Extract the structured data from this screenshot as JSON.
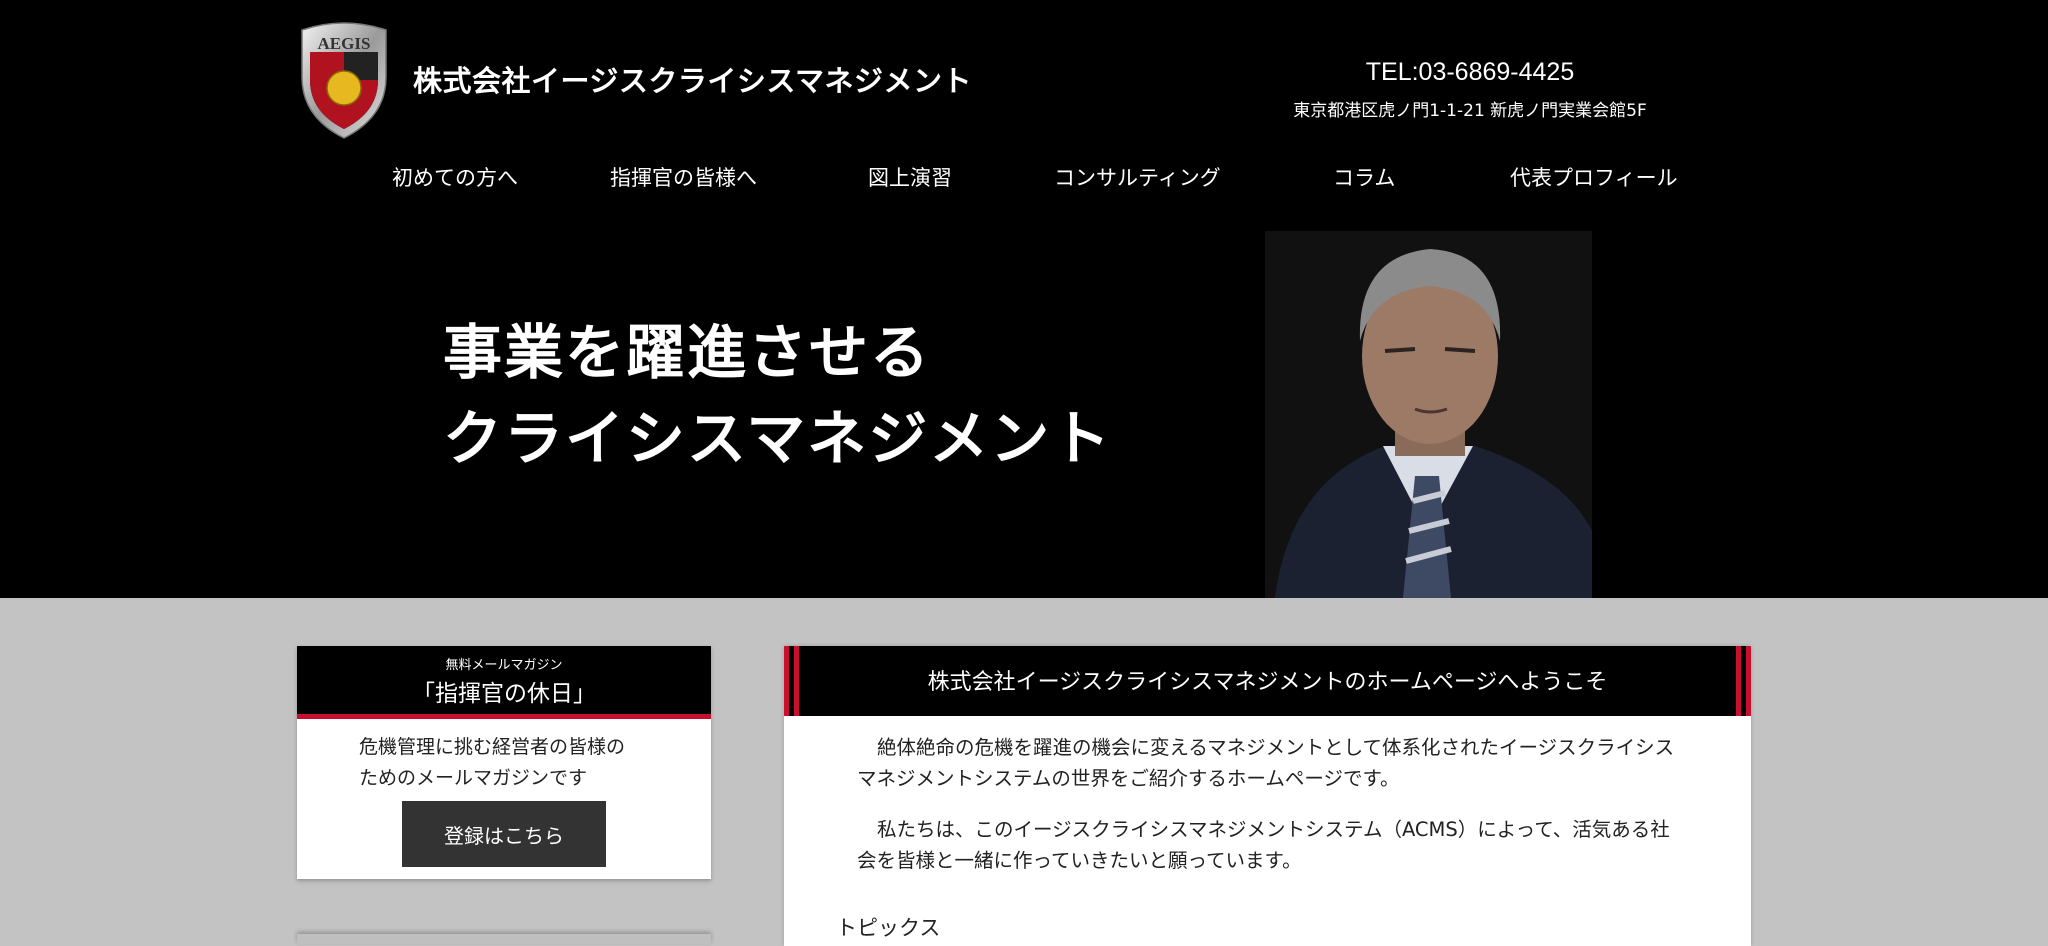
{
  "header": {
    "site_name": "株式会社イージスクライシスマネジメント",
    "logo_text": "AEGIS",
    "tel": "TEL:03-6869-4425",
    "address": "東京都港区虎ノ門1-1-21 新虎ノ門実業会館5F"
  },
  "nav": {
    "items": [
      {
        "label": "初めての方へ"
      },
      {
        "label": "指揮官の皆様へ"
      },
      {
        "label": "図上演習"
      },
      {
        "label": "コンサルティング"
      },
      {
        "label": "コラム"
      },
      {
        "label": "代表プロフィール"
      }
    ]
  },
  "hero": {
    "line1": "事業を躍進させる",
    "line2": "クライシスマネジメント"
  },
  "magazine": {
    "kicker": "無料メールマガジン",
    "title": "「指揮官の休日」",
    "desc_line1": "危機管理に挑む経営者の皆様の",
    "desc_line2": "ためのメールマガジンです",
    "button": "登録はこちら"
  },
  "welcome": {
    "title": "株式会社イージスクライシスマネジメントのホームページへようこそ",
    "p1": "絶体絶命の危機を躍進の機会に変えるマネジメントとして体系化されたイージスクライシスマネジメントシステムの世界をご紹介するホームページです。",
    "p2": "私たちは、このイージスクライシスマネジメントシステム（ACMS）によって、活気ある社会を皆様と一緒に作っていきたいと願っています。",
    "topics": "トピックス"
  },
  "colors": {
    "background_top": "#000000",
    "background_bottom": "#c3c3c3",
    "accent_red": "#c8102e",
    "button_dark": "#333333"
  }
}
